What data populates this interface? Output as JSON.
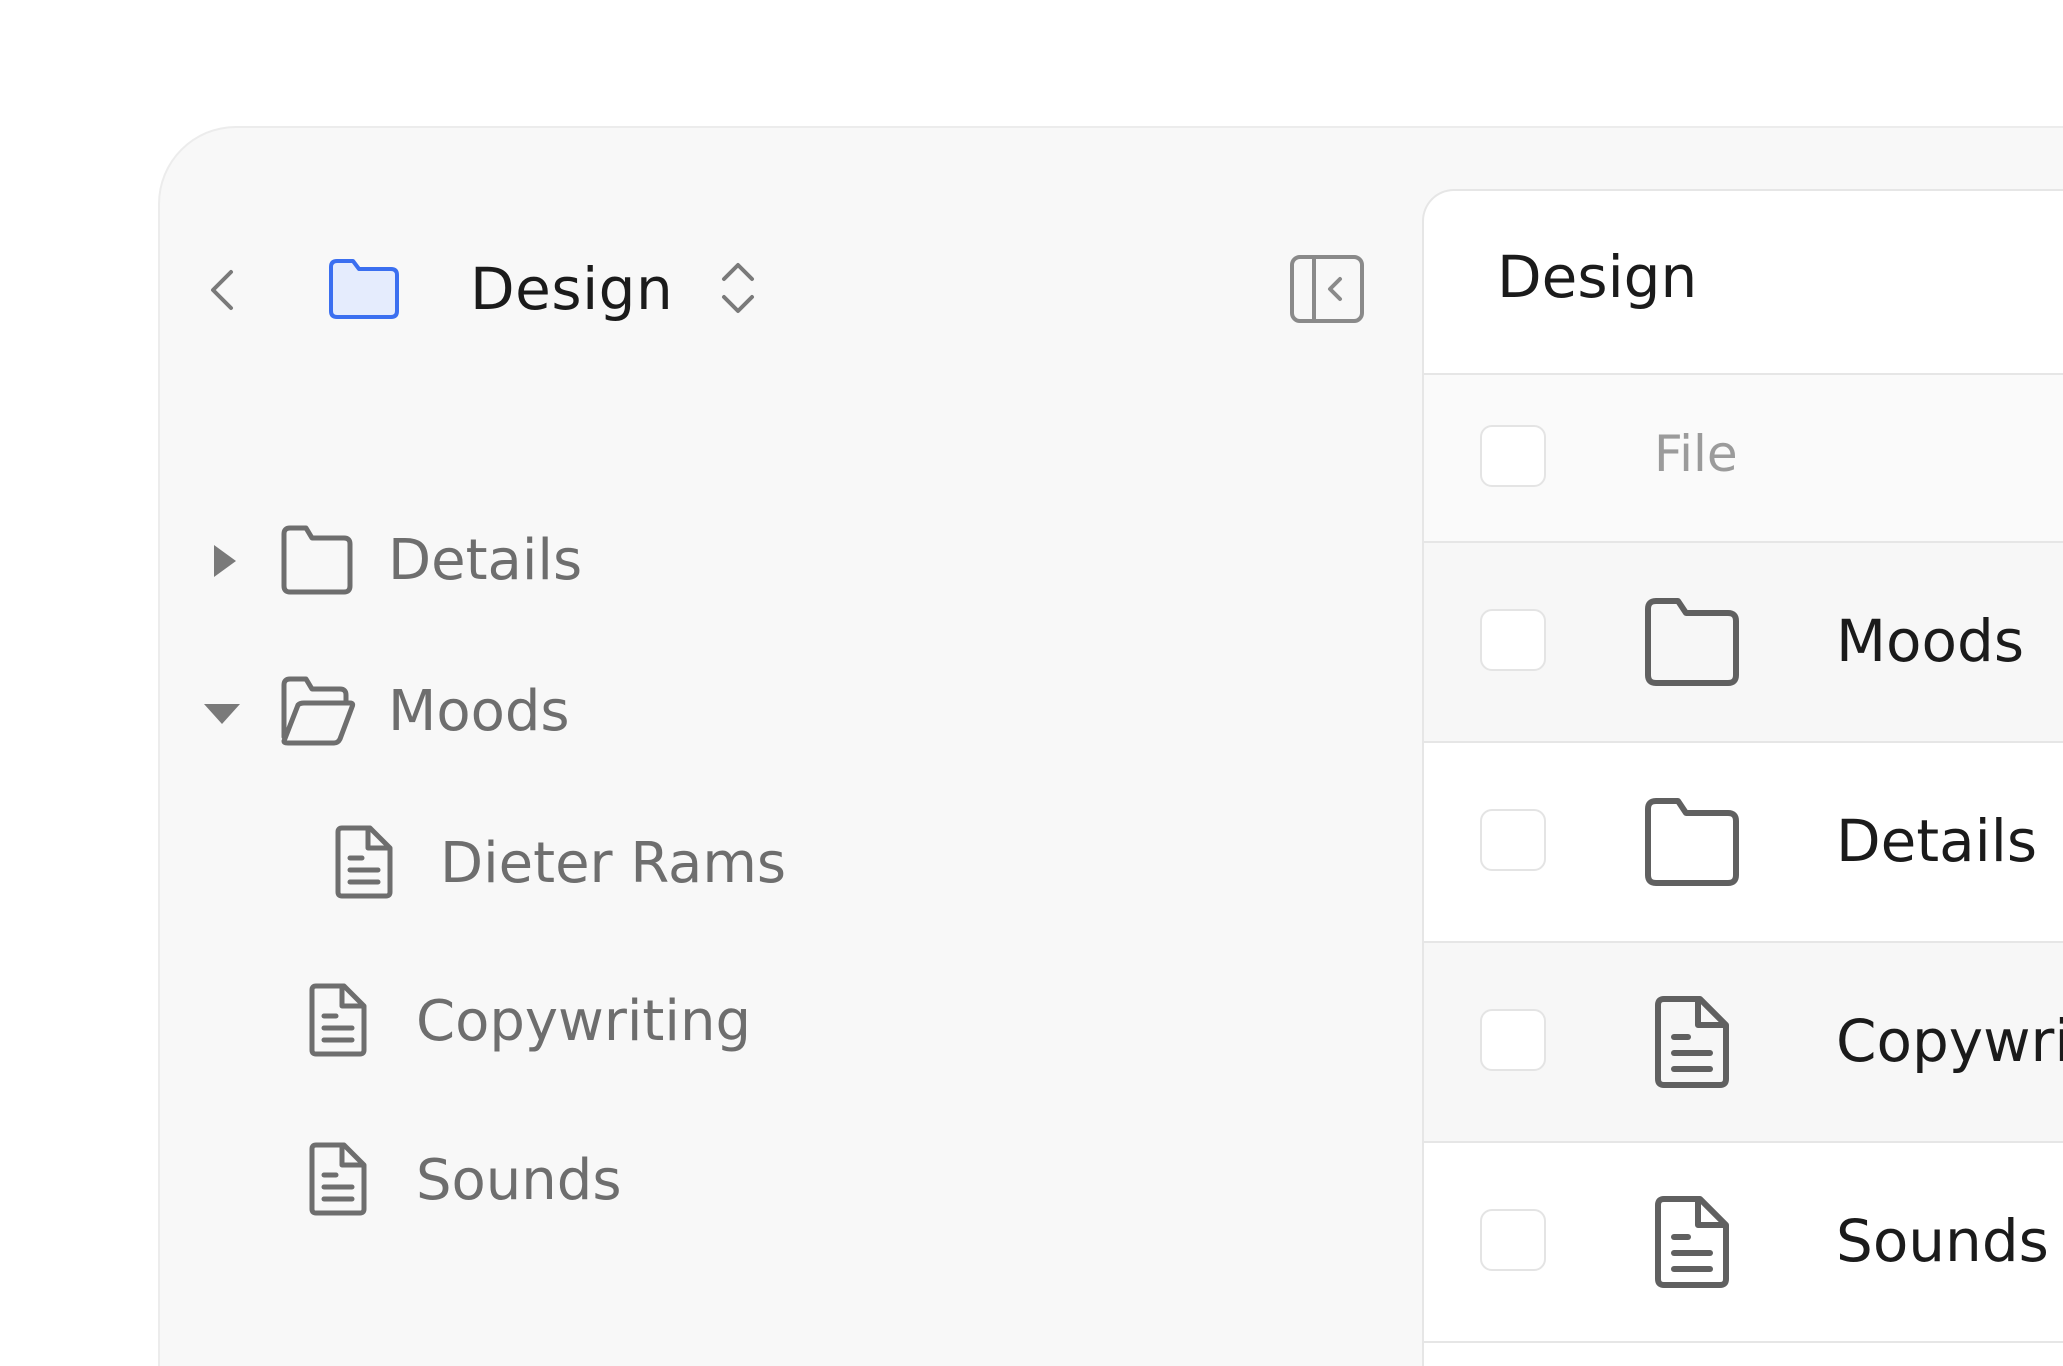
{
  "sidebar": {
    "title": "Design",
    "folder_color": "#3b6ff0",
    "folder_fill": "#e5ecfd",
    "icons": {
      "back": "chevron-left-icon",
      "folder": "folder-icon",
      "switch": "chevron-up-down-icon",
      "collapse": "sidebar-collapse-icon"
    },
    "tree": [
      {
        "label": "Details",
        "type": "folder",
        "state": "collapsed"
      },
      {
        "label": "Moods",
        "type": "folder",
        "state": "expanded"
      },
      {
        "label": "Dieter Rams",
        "type": "file",
        "parent": "Moods"
      },
      {
        "label": "Copywriting",
        "type": "file"
      },
      {
        "label": "Sounds",
        "type": "file"
      }
    ]
  },
  "main": {
    "title": "Design",
    "column_header": "File",
    "rows": [
      {
        "label": "Moods",
        "type": "folder"
      },
      {
        "label": "Details",
        "type": "folder"
      },
      {
        "label": "Copywriting",
        "type": "file"
      },
      {
        "label": "Sounds",
        "type": "file"
      }
    ]
  }
}
